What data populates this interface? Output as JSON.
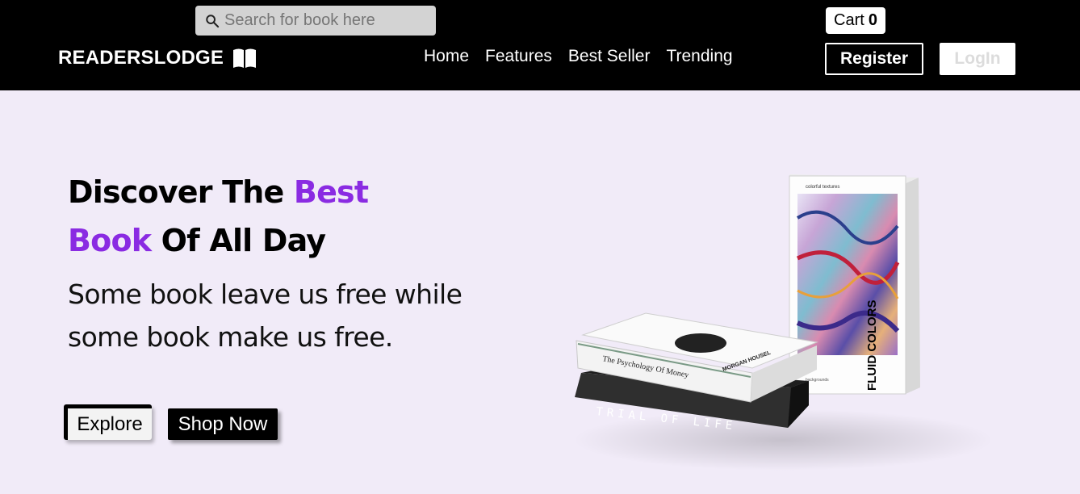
{
  "header": {
    "search": {
      "placeholder": "Search for book here"
    },
    "cart": {
      "label": "Cart",
      "count": "0"
    },
    "logo": {
      "text": "READERSLODGE",
      "icon": "open-book-icon"
    },
    "nav": [
      {
        "label": "Home"
      },
      {
        "label": "Features"
      },
      {
        "label": "Best Seller"
      },
      {
        "label": "Trending"
      }
    ],
    "register_label": "Register",
    "login_label": "LogIn"
  },
  "hero": {
    "title_part1": "Discover The ",
    "title_accent1": "Best",
    "title_accent2": "Book",
    "title_part2": " Of All Day",
    "subtitle": "Some book leave us free while some book make us free.",
    "explore_label": "Explore",
    "shop_label": "Shop Now"
  },
  "illustration": {
    "book_top_title": "The Psychology Of Money",
    "book_top_author": "MORGAN HOUSEL",
    "book_bottom_title": "TRIAL OF LIFE",
    "book_standing_title": "FLUID COLORS",
    "book_standing_tagline": "colorful textures",
    "book_standing_footer": "backgrounds"
  },
  "colors": {
    "accent": "#8a2be2",
    "header_bg": "#000000",
    "page_bg": "#f1ebf8"
  }
}
